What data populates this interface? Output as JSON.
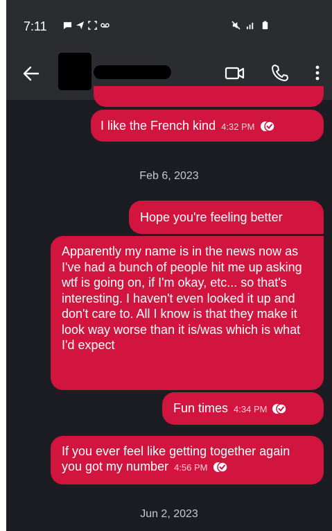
{
  "status_bar": {
    "time": "7:11",
    "left_icons": [
      "chat-bubble-icon",
      "send-icon",
      "screenshot-icon",
      "voicemail-icon"
    ],
    "right_icons": [
      "mute-icon",
      "signal-icon",
      "battery-icon"
    ]
  },
  "header": {
    "contact_name": "",
    "icons": [
      "back-arrow-icon",
      "video-call-icon",
      "phone-icon",
      "more-vert-icon"
    ]
  },
  "messages": [
    {
      "text": "I like the French kind",
      "time": "4:32 PM",
      "read": true
    },
    {
      "date": "Feb 6, 2023"
    },
    {
      "text": "Hope you're feeling better",
      "time": "",
      "read": false
    },
    {
      "text": "Apparently my name is in the news now as I've had a bunch of people hit me up asking wtf is going on, if I'm okay,  etc... so that's interesting. I haven't even looked it up and don't care to. All I know is that they make it look way worse than it is/was which is what I'd expect",
      "time": "",
      "read": false
    },
    {
      "text": "Fun times",
      "time": "4:34 PM",
      "read": true
    },
    {
      "text": "If you ever feel like getting together again you got my number",
      "time": "4:56 PM",
      "read": true
    },
    {
      "date": "Jun 2, 2023"
    }
  ],
  "colors": {
    "bubble": "#d1153f",
    "background": "#1c1d22",
    "header": "#2b2c30"
  }
}
